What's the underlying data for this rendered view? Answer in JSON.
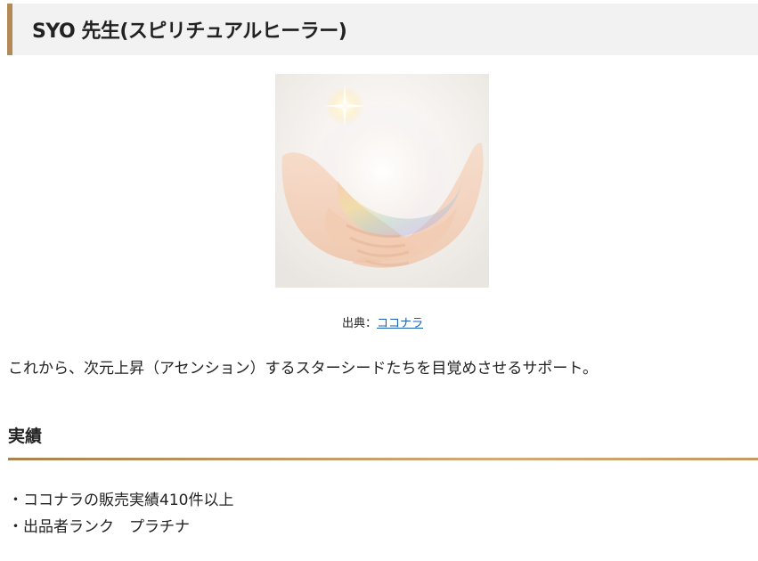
{
  "heading": {
    "title": "SYO 先生(スピリチュアルヒーラー)"
  },
  "figure": {
    "image_alt": "光に包まれた両手の画像",
    "caption_prefix": "出典：",
    "caption_link": "ココナラ"
  },
  "body": {
    "description": "これから、次元上昇（アセンション）するスターシードたちを目覚めさせるサポート。"
  },
  "achievements": {
    "title": "実績",
    "items": [
      "・ココナラの販売実績410件以上",
      "・出品者ランク　プラチナ"
    ]
  },
  "colors": {
    "accent": "#b38a55",
    "heading_background": "#f2f2f2",
    "link": "#1a5fb4",
    "text": "#222222"
  }
}
